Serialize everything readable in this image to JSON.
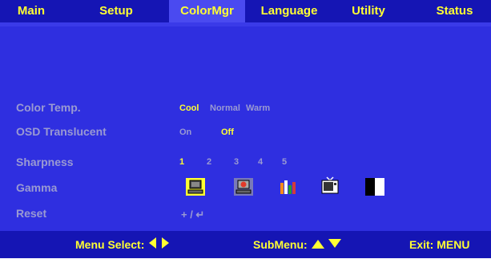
{
  "tabs": [
    {
      "label": "Main"
    },
    {
      "label": "Setup"
    },
    {
      "label": "ColorMgr"
    },
    {
      "label": "Language"
    },
    {
      "label": "Utility"
    },
    {
      "label": "Status"
    }
  ],
  "active_tab": "ColorMgr",
  "rows": {
    "color_temp": {
      "label": "Color Temp.",
      "options": [
        "Cool",
        "Normal",
        "Warm"
      ],
      "selected": "Cool"
    },
    "osd_translucent": {
      "label": "OSD Translucent",
      "options": [
        "On",
        "Off"
      ],
      "selected": "Off"
    },
    "sharpness": {
      "label": "Sharpness",
      "options": [
        "1",
        "2",
        "3",
        "4",
        "5"
      ],
      "selected": "1"
    },
    "gamma": {
      "label": "Gamma",
      "options": [
        "pc-icon",
        "video-icon",
        "chart-icon",
        "tv-icon",
        "black-white-icon"
      ],
      "selected": "pc-icon"
    },
    "reset": {
      "label": "Reset",
      "hint": "+ / ↵"
    }
  },
  "footer": {
    "menu_select": "Menu Select:",
    "submenu": "SubMenu:",
    "exit": "Exit: MENU"
  },
  "colors": {
    "background": "#2f2fe0",
    "bar": "#1515b4",
    "active_tab": "#4a4af0",
    "highlight": "#ffff33",
    "dim_text": "#9a9ad2"
  }
}
